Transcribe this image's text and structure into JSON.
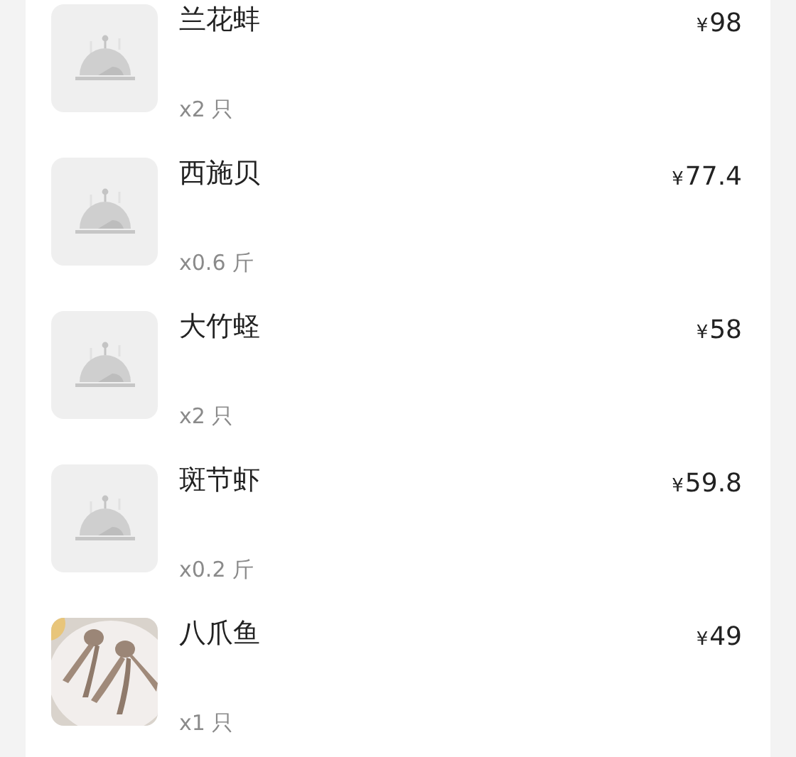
{
  "items": [
    {
      "name": "兰花蚌",
      "quantity": "x2 只",
      "currency": "¥",
      "price": "98",
      "image": {
        "kind": "placeholder"
      }
    },
    {
      "name": "西施贝",
      "quantity": "x0.6 斤",
      "currency": "¥",
      "price": "77.4",
      "image": {
        "kind": "placeholder"
      }
    },
    {
      "name": "大竹蛏",
      "quantity": "x2 只",
      "currency": "¥",
      "price": "58",
      "image": {
        "kind": "placeholder"
      }
    },
    {
      "name": "斑节虾",
      "quantity": "x0.2 斤",
      "currency": "¥",
      "price": "59.8",
      "image": {
        "kind": "placeholder"
      }
    },
    {
      "name": "八爪鱼",
      "quantity": "x1 只",
      "currency": "¥",
      "price": "49"
    }
  ]
}
